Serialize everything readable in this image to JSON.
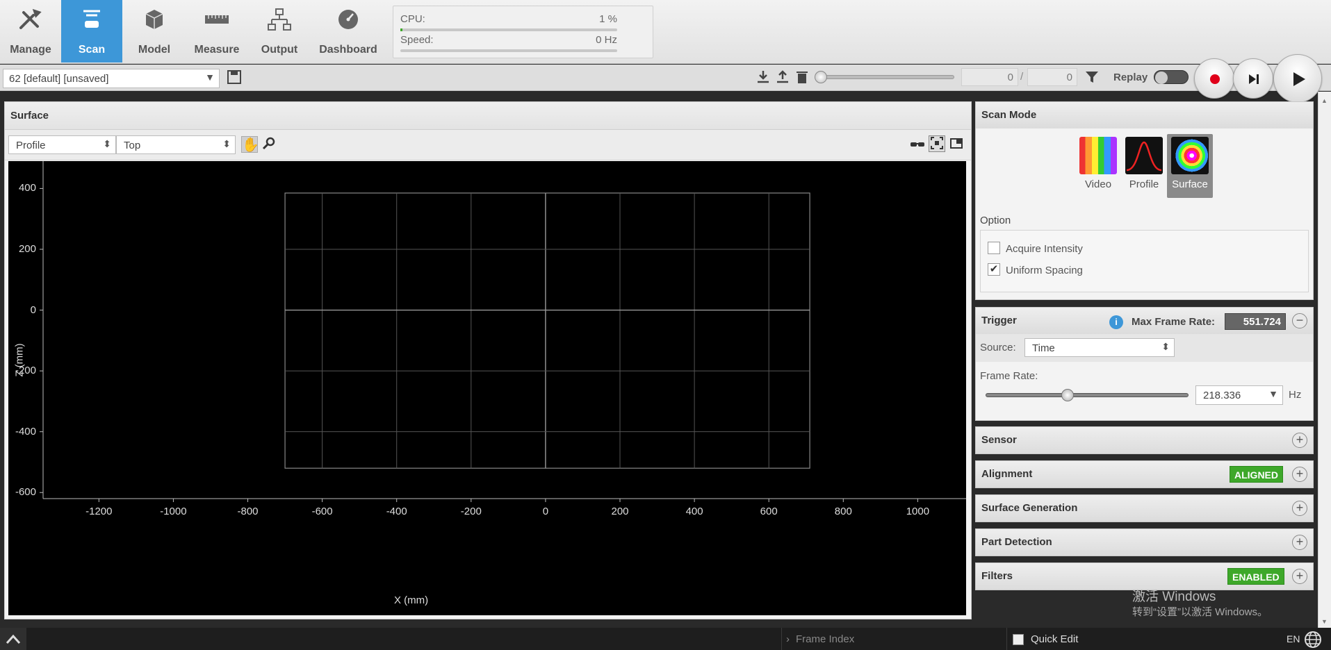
{
  "nav": {
    "tabs": [
      {
        "label": "Manage",
        "icon": "tools-icon"
      },
      {
        "label": "Scan",
        "icon": "scan-icon"
      },
      {
        "label": "Model",
        "icon": "cube-icon"
      },
      {
        "label": "Measure",
        "icon": "ruler-icon"
      },
      {
        "label": "Output",
        "icon": "network-icon"
      },
      {
        "label": "Dashboard",
        "icon": "gauge-icon"
      }
    ],
    "active": "Scan"
  },
  "stats": {
    "cpu_label": "CPU:",
    "cpu_value": "1 %",
    "cpu_fraction": 0.01,
    "speed_label": "Speed:",
    "speed_value": "0 Hz",
    "speed_fraction": 0
  },
  "toolbar": {
    "job": "62 [default] [unsaved]",
    "frame_current": "0",
    "frame_sep": "/",
    "frame_total": "0",
    "replay_label": "Replay"
  },
  "surface": {
    "title": "Surface",
    "view_select": "Profile",
    "orient_select": "Top"
  },
  "chart_data": {
    "type": "scatter",
    "xlabel": "X (mm)",
    "ylabel": "Z (mm)",
    "xlim": [
      -1350,
      1130
    ],
    "ylim": [
      -620,
      490
    ],
    "x_ticks": [
      "-1200",
      "-1000",
      "-800",
      "-600",
      "-400",
      "-200",
      "0",
      "200",
      "400",
      "600",
      "800",
      "1000"
    ],
    "y_ticks": [
      "400",
      "200",
      "0",
      "-200",
      "-400",
      "-600"
    ],
    "grid_box": {
      "x": [
        -700,
        710
      ],
      "z": [
        -520,
        385
      ]
    },
    "series": []
  },
  "scan_mode": {
    "title": "Scan Mode",
    "modes": [
      "Video",
      "Profile",
      "Surface"
    ],
    "selected": "Surface",
    "option_title": "Option",
    "options": [
      {
        "label": "Acquire Intensity",
        "checked": false
      },
      {
        "label": "Uniform Spacing",
        "checked": true
      }
    ]
  },
  "trigger": {
    "title": "Trigger",
    "max_frame_label": "Max Frame Rate:",
    "max_frame_value": "551.724",
    "source_label": "Source:",
    "source_value": "Time",
    "frame_rate_label": "Frame Rate:",
    "frame_rate_value": "218.336",
    "frame_rate_unit": "Hz",
    "frame_rate_fraction": 0.4
  },
  "sections": [
    {
      "title": "Sensor",
      "badge": ""
    },
    {
      "title": "Alignment",
      "badge": "ALIGNED"
    },
    {
      "title": "Surface Generation",
      "badge": ""
    },
    {
      "title": "Part Detection",
      "badge": ""
    },
    {
      "title": "Filters",
      "badge": "ENABLED"
    }
  ],
  "watermark": {
    "line1": "激活 Windows",
    "line2": "转到“设置”以激活 Windows。"
  },
  "status": {
    "frame_index": "Frame Index",
    "quick_edit": "Quick Edit",
    "lang": "EN"
  },
  "colors": {
    "accent": "#3d97d8",
    "badge_green": "#3ea82a",
    "record_red": "#e0001a"
  }
}
